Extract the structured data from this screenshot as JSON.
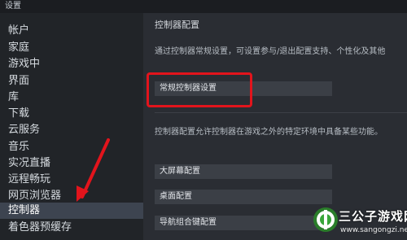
{
  "window": {
    "title": "设置"
  },
  "sidebar": {
    "items": [
      {
        "label": "帐户"
      },
      {
        "label": "家庭"
      },
      {
        "label": "游戏中"
      },
      {
        "label": "界面"
      },
      {
        "label": "库"
      },
      {
        "label": "下载"
      },
      {
        "label": "云服务"
      },
      {
        "label": "音乐"
      },
      {
        "label": "实况直播"
      },
      {
        "label": "远程畅玩"
      },
      {
        "label": "网页浏览器"
      },
      {
        "label": "控制器",
        "selected": true
      },
      {
        "label": "着色器预缓存"
      }
    ]
  },
  "main": {
    "section_title": "控制器配置",
    "intro": "通过控制器常规设置，可设置参与/退出配置支持、个性化及其他",
    "general_button": "常规控制器设置",
    "desc2": "控制器配置允许控制器在游戏之外的特定环境中具备某些功能。",
    "buttons": [
      "大屏幕配置",
      "桌面配置",
      "导航组合键配置"
    ]
  },
  "annotations": {
    "highlight_color": "#e2141c"
  },
  "watermark": {
    "title": "三公子游戏网",
    "url": "www.sangongzi.net"
  }
}
